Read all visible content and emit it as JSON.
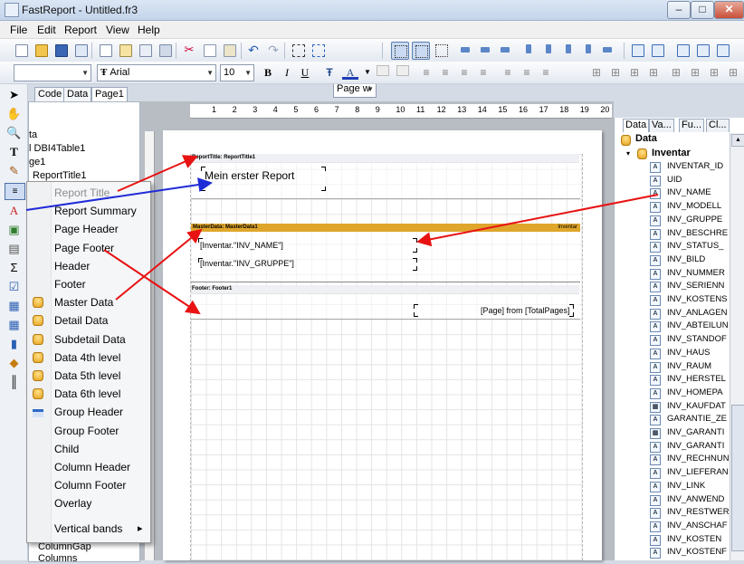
{
  "window": {
    "title": "FastReport - Untitled.fr3",
    "minimize": "–",
    "maximize": "□",
    "close": "✕"
  },
  "menu": [
    "File",
    "Edit",
    "Report",
    "View",
    "Help"
  ],
  "toolbar": {
    "zoom_value": "Page w"
  },
  "format_bar": {
    "style_value": "",
    "font_value": "Arial",
    "size_value": "10",
    "bold": "B",
    "italic": "I",
    "underline": "U"
  },
  "editor_tabs": [
    "Code",
    "Data",
    "Page1"
  ],
  "tree": {
    "items": [
      "ta",
      "l DBI4Table1",
      "ge1",
      "ReportTitle1"
    ],
    "bottom_items": [
      "ColumnGap",
      "Columns"
    ]
  },
  "context_menu": {
    "items": [
      {
        "label": "Report Title",
        "disabled": true,
        "icon": "none"
      },
      {
        "label": "Report Summary",
        "disabled": false,
        "icon": "none"
      },
      {
        "label": "Page Header",
        "disabled": false,
        "icon": "none"
      },
      {
        "label": "Page Footer",
        "disabled": false,
        "icon": "none"
      },
      {
        "label": "Header",
        "disabled": false,
        "icon": "none"
      },
      {
        "label": "Footer",
        "disabled": false,
        "icon": "none"
      },
      {
        "label": "Master Data",
        "disabled": false,
        "icon": "database-icon"
      },
      {
        "label": "Detail Data",
        "disabled": false,
        "icon": "database-icon"
      },
      {
        "label": "Subdetail Data",
        "disabled": false,
        "icon": "database-icon"
      },
      {
        "label": "Data 4th level",
        "disabled": false,
        "icon": "database-icon"
      },
      {
        "label": "Data 5th level",
        "disabled": false,
        "icon": "database-icon"
      },
      {
        "label": "Data 6th level",
        "disabled": false,
        "icon": "database-icon"
      },
      {
        "label": "Group Header",
        "disabled": false,
        "icon": "group-header-icon"
      },
      {
        "label": "Group Footer",
        "disabled": false,
        "icon": "none"
      },
      {
        "label": "Child",
        "disabled": false,
        "icon": "none"
      },
      {
        "label": "Column Header",
        "disabled": false,
        "icon": "none"
      },
      {
        "label": "Column Footer",
        "disabled": false,
        "icon": "none"
      },
      {
        "label": "Overlay",
        "disabled": false,
        "icon": "none"
      }
    ],
    "submenu": {
      "label": "Vertical bands",
      "arrow": "▸"
    }
  },
  "ruler": [
    "1",
    "2",
    "3",
    "4",
    "5",
    "6",
    "7",
    "8",
    "9",
    "10",
    "11",
    "12",
    "13",
    "14",
    "15",
    "16",
    "17",
    "18",
    "19",
    "20"
  ],
  "report": {
    "title_band": "ReportTitle: ReportTitle1",
    "title_text": "Mein erster Report",
    "masterdata_band": "MasterData: MasterData1",
    "masterdata_source": "Inventar",
    "field1": "[Inventar.\"INV_NAME\"]",
    "field2": "[Inventar.\"INV_GRUPPE\"]",
    "footer_band": "Footer: Footer1",
    "footer_text": "[Page] from [TotalPages]",
    "band_color": "#dfa62b"
  },
  "right_panel": {
    "tabs": [
      "Data",
      "Va...",
      "Fu...",
      "Cl..."
    ],
    "root": "Data",
    "dataset": "Inventar",
    "fields": [
      {
        "name": "INVENTAR_ID",
        "type": "text"
      },
      {
        "name": "UID",
        "type": "text"
      },
      {
        "name": "INV_NAME",
        "type": "text"
      },
      {
        "name": "INV_MODELL",
        "type": "text"
      },
      {
        "name": "INV_GRUPPE",
        "type": "text"
      },
      {
        "name": "INV_BESCHRE",
        "type": "text"
      },
      {
        "name": "INV_STATUS_",
        "type": "text"
      },
      {
        "name": "INV_BILD",
        "type": "text"
      },
      {
        "name": "INV_NUMMER",
        "type": "text"
      },
      {
        "name": "INV_SERIENN",
        "type": "text"
      },
      {
        "name": "INV_KOSTENS",
        "type": "text"
      },
      {
        "name": "INV_ANLAGEN",
        "type": "text"
      },
      {
        "name": "INV_ABTEILUN",
        "type": "text"
      },
      {
        "name": "INV_STANDOF",
        "type": "text"
      },
      {
        "name": "INV_HAUS",
        "type": "text"
      },
      {
        "name": "INV_RAUM",
        "type": "text"
      },
      {
        "name": "INV_HERSTEL",
        "type": "text"
      },
      {
        "name": "INV_HOMEPA",
        "type": "text"
      },
      {
        "name": "INV_KAUFDAT",
        "type": "date"
      },
      {
        "name": "GARANTIE_ZE",
        "type": "text"
      },
      {
        "name": "INV_GARANTI",
        "type": "date"
      },
      {
        "name": "INV_GARANTI",
        "type": "text"
      },
      {
        "name": "INV_RECHNUN",
        "type": "text"
      },
      {
        "name": "INV_LIEFERAN",
        "type": "text"
      },
      {
        "name": "INV_LINK",
        "type": "text"
      },
      {
        "name": "INV_ANWEND",
        "type": "text"
      },
      {
        "name": "INV_RESTWER",
        "type": "text"
      },
      {
        "name": "INV_ANSCHAF",
        "type": "text"
      },
      {
        "name": "INV_KOSTEN",
        "type": "text"
      },
      {
        "name": "INV_KOSTENF",
        "type": "text"
      }
    ]
  },
  "colors": {
    "arrow_red": "#e81212",
    "arrow_blue": "#1f2bd6"
  }
}
